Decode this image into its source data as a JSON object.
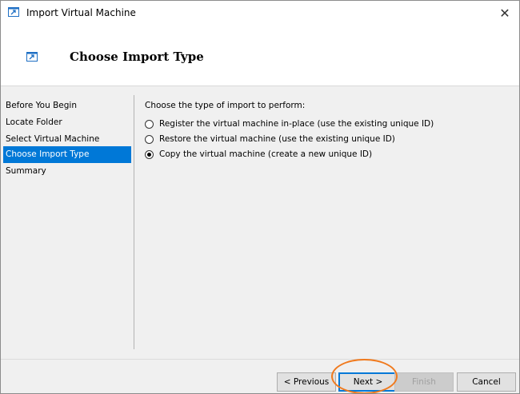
{
  "window": {
    "title": "Import Virtual Machine",
    "close_glyph": "✕"
  },
  "header": {
    "title": "Choose Import Type"
  },
  "sidebar": {
    "items": [
      {
        "label": "Before You Begin",
        "active": false
      },
      {
        "label": "Locate Folder",
        "active": false
      },
      {
        "label": "Select Virtual Machine",
        "active": false
      },
      {
        "label": "Choose Import Type",
        "active": true
      },
      {
        "label": "Summary",
        "active": false
      }
    ]
  },
  "content": {
    "prompt": "Choose the type of import to perform:",
    "options": [
      {
        "label": "Register the virtual machine in-place (use the existing unique ID)",
        "checked": false
      },
      {
        "label": "Restore the virtual machine (use the existing unique ID)",
        "checked": false
      },
      {
        "label": "Copy the virtual machine (create a new unique ID)",
        "checked": true
      }
    ]
  },
  "buttons": {
    "previous": "< Previous",
    "next": "Next >",
    "finish": "Finish",
    "cancel": "Cancel"
  },
  "colors": {
    "accent": "#0078d7",
    "highlight": "#f07a1e"
  },
  "icons": {
    "app": "import-vm-icon",
    "close": "close-icon"
  }
}
